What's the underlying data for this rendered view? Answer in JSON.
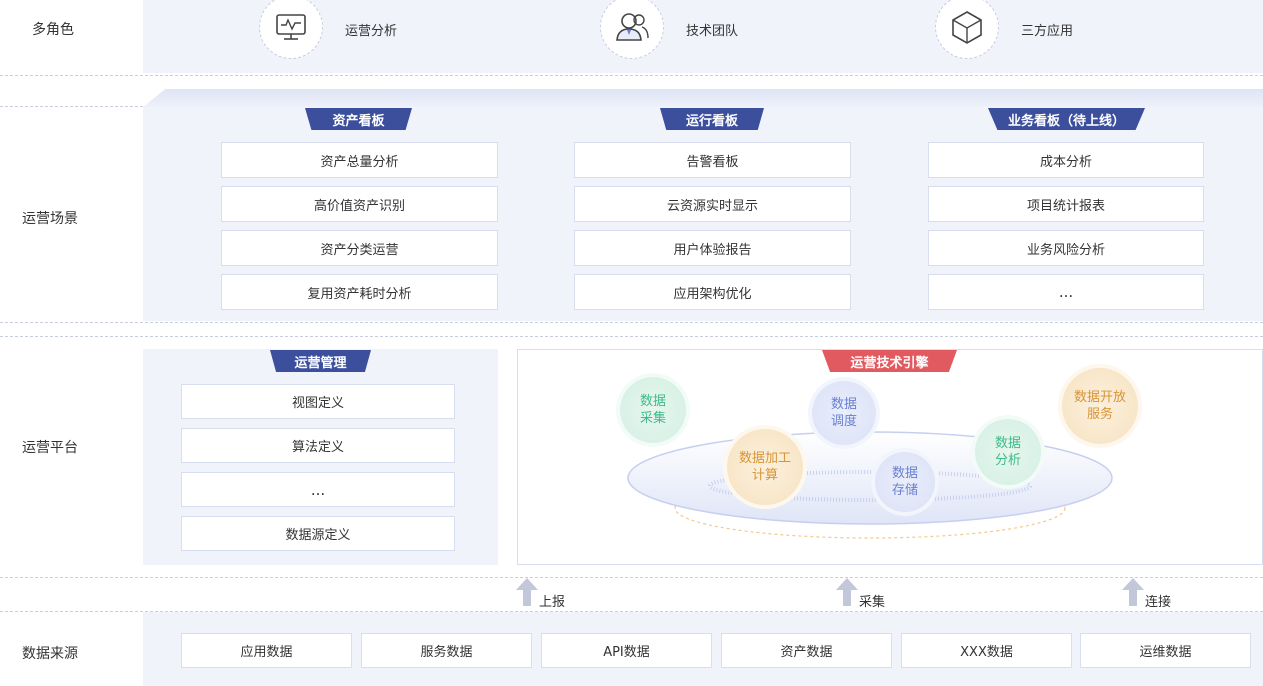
{
  "rows": {
    "roles": "多角色",
    "scenes": "运营场景",
    "platform": "运营平台",
    "sources": "数据来源"
  },
  "roles": [
    {
      "label": "运营分析",
      "icon": "monitor-chart-icon"
    },
    {
      "label": "技术团队",
      "icon": "team-icon"
    },
    {
      "label": "三方应用",
      "icon": "cube-icon"
    }
  ],
  "boards": [
    {
      "title": "资产看板",
      "items": [
        "资产总量分析",
        "高价值资产识别",
        "资产分类运营",
        "复用资产耗时分析"
      ]
    },
    {
      "title": "运行看板",
      "items": [
        "告警看板",
        "云资源实时显示",
        "用户体验报告",
        "应用架构优化"
      ]
    },
    {
      "title": "业务看板（待上线）",
      "items": [
        "成本分析",
        "项目统计报表",
        "业务风险分析",
        "..."
      ]
    }
  ],
  "management": {
    "title": "运营管理",
    "items": [
      "视图定义",
      "算法定义",
      "...",
      "数据源定义"
    ]
  },
  "engine": {
    "title": "运营技术引擎",
    "bubbles": {
      "collect": [
        "数据",
        "采集"
      ],
      "schedule": [
        "数据",
        "调度"
      ],
      "compute": [
        "数据加工",
        "计算"
      ],
      "storage": [
        "数据",
        "存储"
      ],
      "analysis": [
        "数据",
        "分析"
      ],
      "open": [
        "数据开放",
        "服务"
      ]
    }
  },
  "arrows": [
    "上报",
    "采集",
    "连接"
  ],
  "sources": [
    "应用数据",
    "服务数据",
    "API数据",
    "资产数据",
    "XXX数据",
    "运维数据"
  ],
  "colors": {
    "tab_blue": "#3b4f9c",
    "tab_red": "#e15a5f",
    "band": "#f1f3fb",
    "green": "#3dbb8a",
    "blue": "#6a7fd1",
    "orange": "#d99434"
  }
}
